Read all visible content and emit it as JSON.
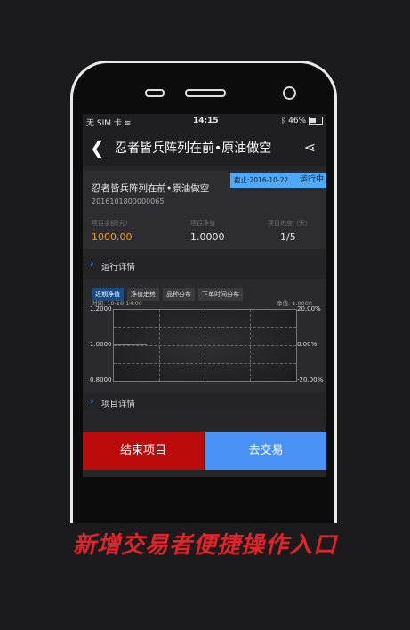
{
  "status_bar": {
    "carrier": "无 SIM 卡",
    "time": "14:15",
    "battery": "46%"
  },
  "nav": {
    "title": "忍者皆兵阵列在前•原油做空"
  },
  "project": {
    "deadline": "截止:2016-10-22",
    "status": "运行中",
    "name": "忍者皆兵阵列在前•原油做空",
    "id": "2016101800000065",
    "amount_label": "项目金额(元)",
    "amount": "1000.00",
    "nav_label": "项目净值",
    "nav_value": "1.0000",
    "progress_label": "项目进度（天）",
    "progress": "1/5"
  },
  "sections": {
    "run_details": "运行详情",
    "project_details": "项目详情"
  },
  "chart_tabs": [
    "近期净值",
    "净值走势",
    "品种分布",
    "下单时间分布"
  ],
  "chart_meta": {
    "time": "时间:  10-18 14:00",
    "nav": "净值:   1.0000"
  },
  "chart_data": {
    "type": "line",
    "left_axis": [
      "1.2000",
      "1.0000",
      "0.8000"
    ],
    "right_axis": [
      "20.00%",
      "0.00%",
      "-20.00%"
    ],
    "ylim": [
      0.8,
      1.2
    ],
    "series": [
      {
        "values": [
          1.0,
          1.0
        ]
      }
    ]
  },
  "buttons": {
    "end": "结束项目",
    "trade": "去交易"
  },
  "slogan": "新增交易者便捷操作入口"
}
